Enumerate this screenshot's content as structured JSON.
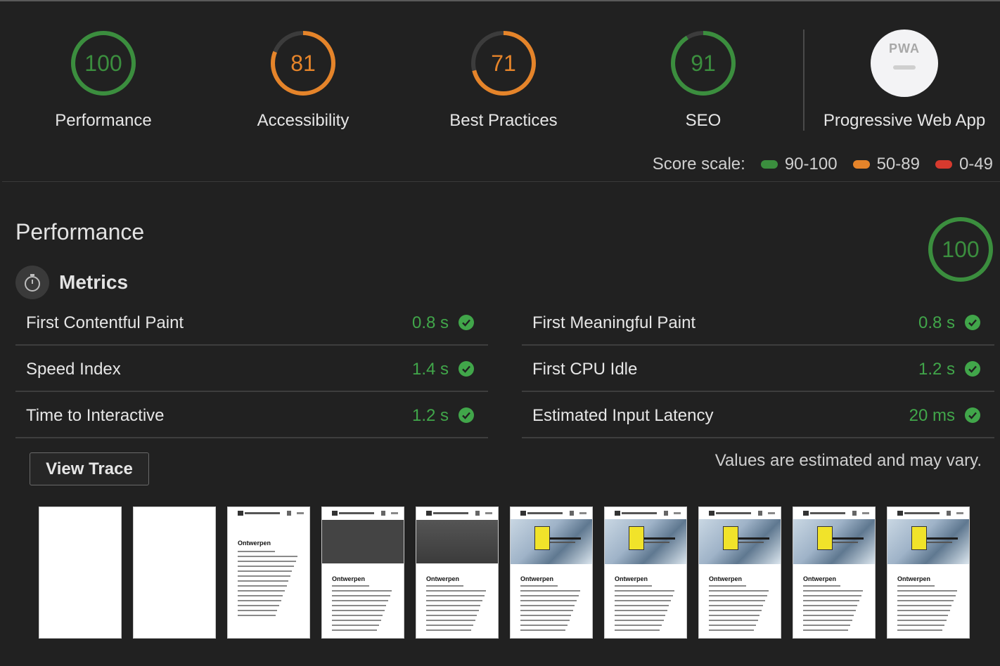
{
  "colors": {
    "pass": "#3b8e3e",
    "average": "#e5842a",
    "fail": "#d63a2e",
    "track": "#3c3c3c",
    "pass_text": "#41a64a"
  },
  "gauges": [
    {
      "score": "100",
      "label": "Performance",
      "value": 1.0,
      "color": "#3b8e3e"
    },
    {
      "score": "81",
      "label": "Accessibility",
      "value": 0.81,
      "color": "#e5842a"
    },
    {
      "score": "71",
      "label": "Best Practices",
      "value": 0.71,
      "color": "#e5842a"
    },
    {
      "score": "91",
      "label": "SEO",
      "value": 0.91,
      "color": "#3b8e3e"
    }
  ],
  "pwa": {
    "badge_text": "PWA",
    "label": "Progressive Web App"
  },
  "score_scale": {
    "label": "Score scale:",
    "ranges": [
      {
        "text": "90-100",
        "color": "#3b8e3e"
      },
      {
        "text": "50-89",
        "color": "#e5842a"
      },
      {
        "text": "0-49",
        "color": "#d63a2e"
      }
    ]
  },
  "performance": {
    "title": "Performance",
    "score": "100",
    "metrics_title": "Metrics",
    "metrics": [
      {
        "name": "First Contentful Paint",
        "value": "0.8 s"
      },
      {
        "name": "First Meaningful Paint",
        "value": "0.8 s"
      },
      {
        "name": "Speed Index",
        "value": "1.4 s"
      },
      {
        "name": "First CPU Idle",
        "value": "1.2 s"
      },
      {
        "name": "Time to Interactive",
        "value": "1.2 s"
      },
      {
        "name": "Estimated Input Latency",
        "value": "20 ms"
      }
    ],
    "view_trace_label": "View Trace",
    "note": "Values are estimated and may vary."
  },
  "filmstrip": {
    "heading": "Ontwerpen",
    "frames": [
      "blank",
      "blank",
      "text",
      "dark",
      "dark",
      "image",
      "image",
      "image",
      "image",
      "image"
    ]
  }
}
